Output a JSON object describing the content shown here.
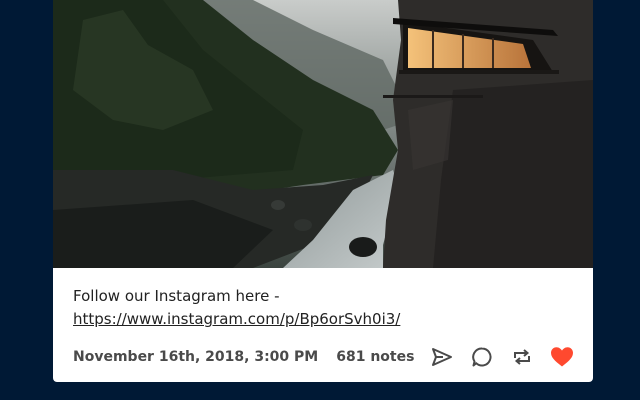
{
  "post": {
    "caption_text": "Follow our Instagram here -",
    "caption_link": "https://www.instagram.com/p/Bp6orSvh0i3/",
    "date": "November 16th, 2018, 3:00 PM",
    "notes": "681 notes"
  },
  "icons": {
    "share": "share-icon",
    "reply": "reply-icon",
    "reblog": "reblog-icon",
    "like": "heart-icon"
  },
  "colors": {
    "page_background": "#001935",
    "like_active": "#ff492f",
    "meta_text": "#4a4a4a"
  }
}
